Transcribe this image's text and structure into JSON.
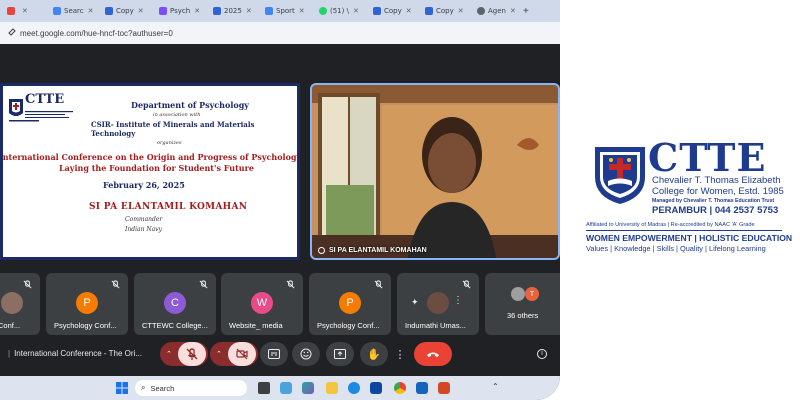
{
  "browser": {
    "tabs": [
      {
        "label": "",
        "favicon_color": "#e8453c"
      },
      {
        "label": "Searc",
        "favicon_color": "#4285f4"
      },
      {
        "label": "Copy",
        "favicon_color": "#2f63d6"
      },
      {
        "label": "Psych",
        "favicon_color": "#7c4dff"
      },
      {
        "label": "2025",
        "favicon_color": "#2f63d6"
      },
      {
        "label": "Sport",
        "favicon_color": "#4285f4"
      },
      {
        "label": "(51) \\",
        "favicon_color": "#25d366"
      },
      {
        "label": "Copy",
        "favicon_color": "#2f63d6"
      },
      {
        "label": "Copy",
        "favicon_color": "#2f63d6"
      },
      {
        "label": "Agen",
        "favicon_color": "#5f6368"
      }
    ],
    "url": "meet.google.com/hue-hncf-toc?authuser=0"
  },
  "slide": {
    "dept": "Department of Psychology",
    "assoc": "in association with",
    "csir": "CSIR- Institute of Minerals and Materials Technology",
    "organizes": "organizes",
    "conference_line1": "International Conference on the Origin and Progress of Psychology:",
    "conference_line2": "Laying the Foundation for Student's Future",
    "date": "February 26, 2025",
    "speaker": "SI PA ELANTAMIL KOMAHAN",
    "role": "Commander",
    "org": "Indian Navy",
    "logo_text": "CTTE"
  },
  "video": {
    "name": "SI PA ELANTAMIL KOMAHAN"
  },
  "participants": [
    {
      "name": "gy Conf...",
      "initial": "",
      "color": "#8d6e63"
    },
    {
      "name": "Psychology Conf...",
      "initial": "P",
      "color": "#f57c00"
    },
    {
      "name": "CTTEWC College...",
      "initial": "C",
      "color": "#8e5bd6"
    },
    {
      "name": "Website_ media",
      "initial": "W",
      "color": "#e84a8a"
    },
    {
      "name": "Psychology Conf...",
      "initial": "P",
      "color": "#f57c00"
    },
    {
      "name": "Indumathi Umas...",
      "initial": "",
      "color": "#6d4c41"
    },
    {
      "name": "36 others",
      "initial": "T",
      "color": "#e8623c"
    }
  ],
  "meeting": {
    "title": "International Conference - The Ori..."
  },
  "taskbar": {
    "search_placeholder": "Search"
  },
  "brand": {
    "wordmark": "CTTE",
    "name_line1": "Chevalier T. Thomas Elizabeth",
    "name_line2": "College for Women, Estd. 1985",
    "managed_by": "Managed by Chevalier T. Thomas Education Trust",
    "place_phone": "PERAMBUR | 044 2537 5753",
    "affiliation": "Affiliated to University of Madras | Re-accredited by NAAC 'A' Grade",
    "tagline": "WOMEN EMPOWERMENT | HOLISTIC EDUCATION",
    "values": "Values | Knowledge | Skills | Quality | Lifelong Learning",
    "color": "#1f3b8f"
  }
}
